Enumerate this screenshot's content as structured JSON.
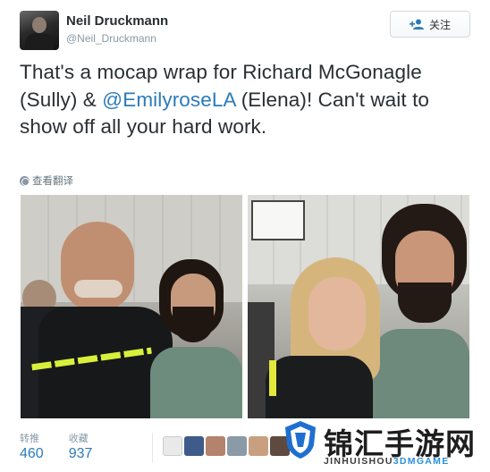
{
  "author": {
    "name": "Neil Druckmann",
    "handle": "@Neil_Druckmann"
  },
  "follow": {
    "label": "关注"
  },
  "tweet": {
    "text_before": "That's a mocap wrap for Richard McGonagle (Sully) & ",
    "mention": "@EmilyroseLA",
    "text_after": " (Elena)! Can't wait to show off all your hard work."
  },
  "translate": {
    "label": "查看翻译"
  },
  "stats": {
    "retweets_label": "转推",
    "retweets_value": "460",
    "likes_label": "收藏",
    "likes_value": "937"
  },
  "watermark": {
    "title": "锦汇手游网",
    "sub_main": "JINHUISHOU",
    "sub_accent": "3DMGAME"
  },
  "colors": {
    "link": "#2b7bb9",
    "muted": "#8899a6",
    "text": "#292f33"
  }
}
